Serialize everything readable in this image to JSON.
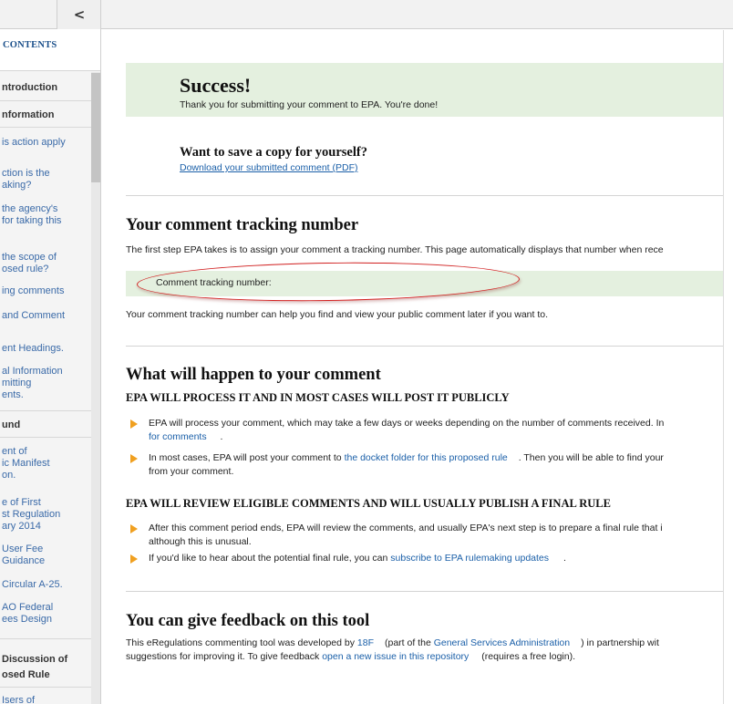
{
  "sidebar": {
    "collapse_icon": "chevron-left-icon",
    "collapse_glyph": "<",
    "contents_label": "CONTENTS",
    "items": [
      {
        "text": "ntroduction"
      },
      {
        "text": "nformation"
      },
      {
        "text": "is action apply"
      },
      {
        "text": "ction is the"
      },
      {
        "text": "aking?"
      },
      {
        "text": "the agency's"
      },
      {
        "text": "for taking this"
      },
      {
        "text": "the scope of"
      },
      {
        "text": "osed rule?"
      },
      {
        "text": "ing comments"
      },
      {
        "text": "and Comment"
      },
      {
        "text": "ent Headings."
      },
      {
        "text": "al Information"
      },
      {
        "text": "mitting"
      },
      {
        "text": "ents."
      },
      {
        "text": "und"
      },
      {
        "text": "ent of"
      },
      {
        "text": "ic Manifest"
      },
      {
        "text": "on."
      },
      {
        "text": "e of First"
      },
      {
        "text": "st Regulation"
      },
      {
        "text": "ary 2014"
      },
      {
        "text": "User Fee"
      },
      {
        "text": "Guidance"
      },
      {
        "text": "Circular A-25."
      },
      {
        "text": "AO Federal"
      },
      {
        "text": "ees Design"
      },
      {
        "text": "Discussion of"
      },
      {
        "text": "osed Rule"
      },
      {
        "text": "Isers of"
      }
    ]
  },
  "success": {
    "title": "Success!",
    "message": "Thank you for submitting your comment to EPA. You're done!"
  },
  "save_copy": {
    "heading": "Want to save a copy for yourself?",
    "link": "Download your submitted comment (PDF)"
  },
  "tracking": {
    "heading": "Your comment tracking number",
    "intro": "The first step EPA takes is to assign your comment a tracking number. This page automatically displays that number when rece",
    "label": "Comment tracking number:",
    "note": "Your comment tracking number can help you find and view your public comment later if you want to."
  },
  "happen": {
    "heading": "What will happen to your comment",
    "sub1": "EPA WILL PROCESS IT AND IN MOST CASES WILL POST IT PUBLICLY",
    "b1_text": "EPA will process your comment, which may take a few days or weeks depending on the number of comments received. In",
    "b1_link": "for comments",
    "b1_end": ".",
    "b2_pre": "In most cases, EPA will post your comment to ",
    "b2_link": "the docket folder for this proposed rule",
    "b2_post": ". Then you will be able to find your",
    "b2_line2": "from your comment.",
    "sub2": "EPA WILL REVIEW ELIGIBLE COMMENTS AND WILL USUALLY PUBLISH A FINAL RULE",
    "b3_text": "After this comment period ends, EPA will review the comments, and usually EPA's next step is to prepare a final rule that i",
    "b3_line2": "although this is unusual.",
    "b4_pre": "If you'd like to hear about the potential final rule, you can ",
    "b4_link": "subscribe to EPA rulemaking updates",
    "b4_post": "."
  },
  "feedback": {
    "heading": "You can give feedback on this tool",
    "l1_pre": "This eRegulations commenting tool was developed by ",
    "l1_link1": "18F",
    "l1_mid": "(part of the ",
    "l1_link2": "General Services Administration",
    "l1_post": ") in partnership wit",
    "l2_pre": "suggestions for improving it. To give feedback ",
    "l2_link": "open a new issue in this repository",
    "l2_post": "(requires a free login)."
  },
  "colors": {
    "success_bg": "#e4f0df",
    "link": "#1a5fa8",
    "bullet": "#f0a020",
    "highlight_ellipse": "#d22222"
  }
}
